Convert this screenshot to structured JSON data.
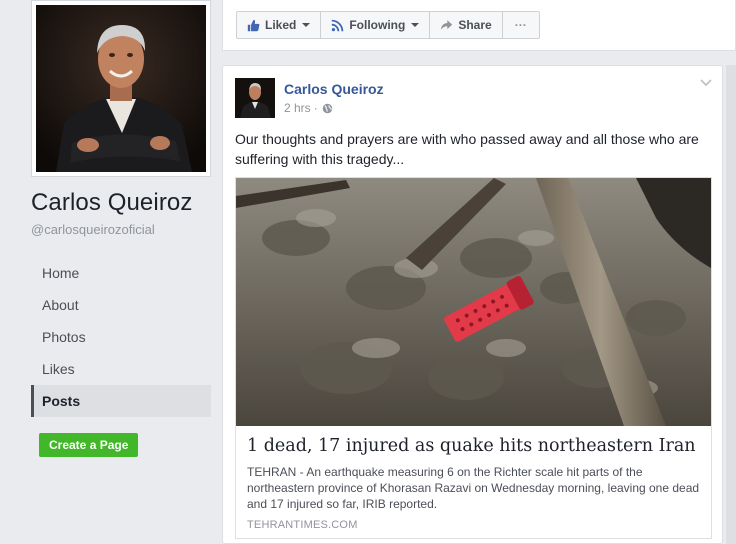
{
  "page": {
    "name": "Carlos Queiroz",
    "handle": "@carlosqueirozoficial"
  },
  "nav": {
    "items": [
      {
        "label": "Home"
      },
      {
        "label": "About"
      },
      {
        "label": "Photos"
      },
      {
        "label": "Likes"
      },
      {
        "label": "Posts"
      }
    ],
    "active": "Posts"
  },
  "create_page_label": "Create a Page",
  "actions": {
    "liked_label": "Liked",
    "following_label": "Following",
    "share_label": "Share",
    "more_label": "···"
  },
  "post": {
    "author": "Carlos Queiroz",
    "time": "2 hrs",
    "separator": "·",
    "text": "Our thoughts and prayers are with who passed away and all those who are suffering with this tragedy...",
    "link": {
      "title": "1 dead, 17 injured as quake hits northeastern Iran",
      "description": "TEHRAN - An earthquake measuring 6 on the Richter scale hit parts of the northeastern province of Khorasan Razavi on Wednesday morning, leaving one dead and 17 injured so far, IRIB reported.",
      "domain": "TEHRANTIMES.COM"
    }
  },
  "colors": {
    "link_blue": "#365899",
    "like_blue": "#4267b2",
    "create_green": "#42b72a",
    "page_bg": "#e9ebee"
  },
  "icons": {
    "liked": "thumbs-up-icon",
    "following": "rss-icon",
    "share": "share-arrow-icon",
    "privacy": "globe-icon",
    "post_menu": "chevron-down-icon"
  }
}
